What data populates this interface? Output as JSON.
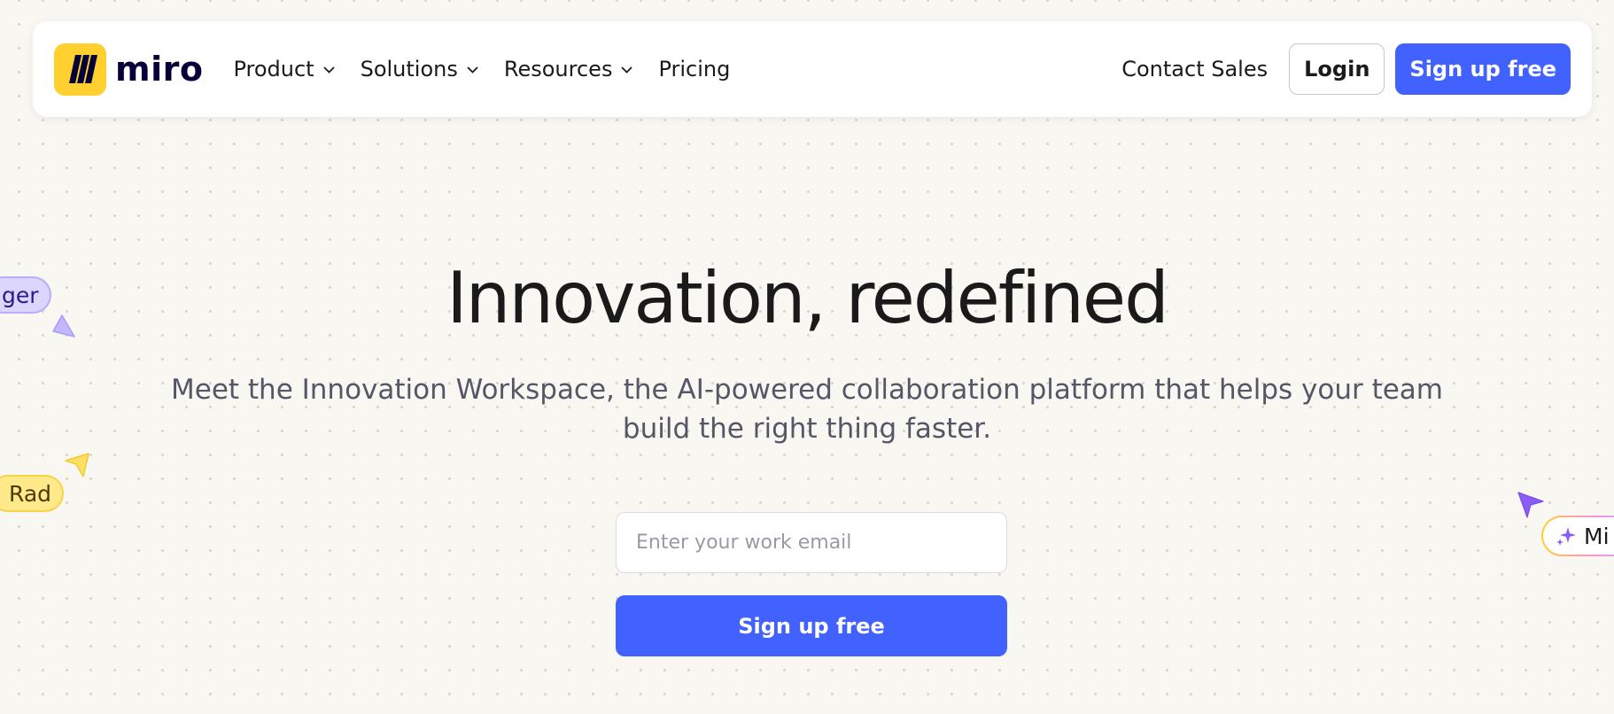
{
  "brand": {
    "name": "miro",
    "logo_color": "#ffd02f",
    "accent_color": "#4262ff"
  },
  "nav": {
    "items": [
      {
        "label": "Product",
        "has_dropdown": true
      },
      {
        "label": "Solutions",
        "has_dropdown": true
      },
      {
        "label": "Resources",
        "has_dropdown": true
      },
      {
        "label": "Pricing",
        "has_dropdown": false
      }
    ],
    "contact_label": "Contact Sales",
    "login_label": "Login",
    "signup_label": "Sign up free"
  },
  "hero": {
    "title": "Innovation, redefined",
    "subtitle": "Meet the Innovation Workspace, the AI-powered collaboration platform that helps your team build the right thing faster.",
    "email_placeholder": "Enter your work email",
    "cta_label": "Sign up free"
  },
  "cursors": [
    {
      "label": "ger",
      "color": "#dcd6ff",
      "icon": "cursor-arrow-icon"
    },
    {
      "label": "Rad",
      "color": "#ffe98a",
      "icon": "cursor-arrow-icon"
    },
    {
      "label": "Mi",
      "color": "#8b5cf6",
      "icon": "sparkle-icon"
    }
  ]
}
